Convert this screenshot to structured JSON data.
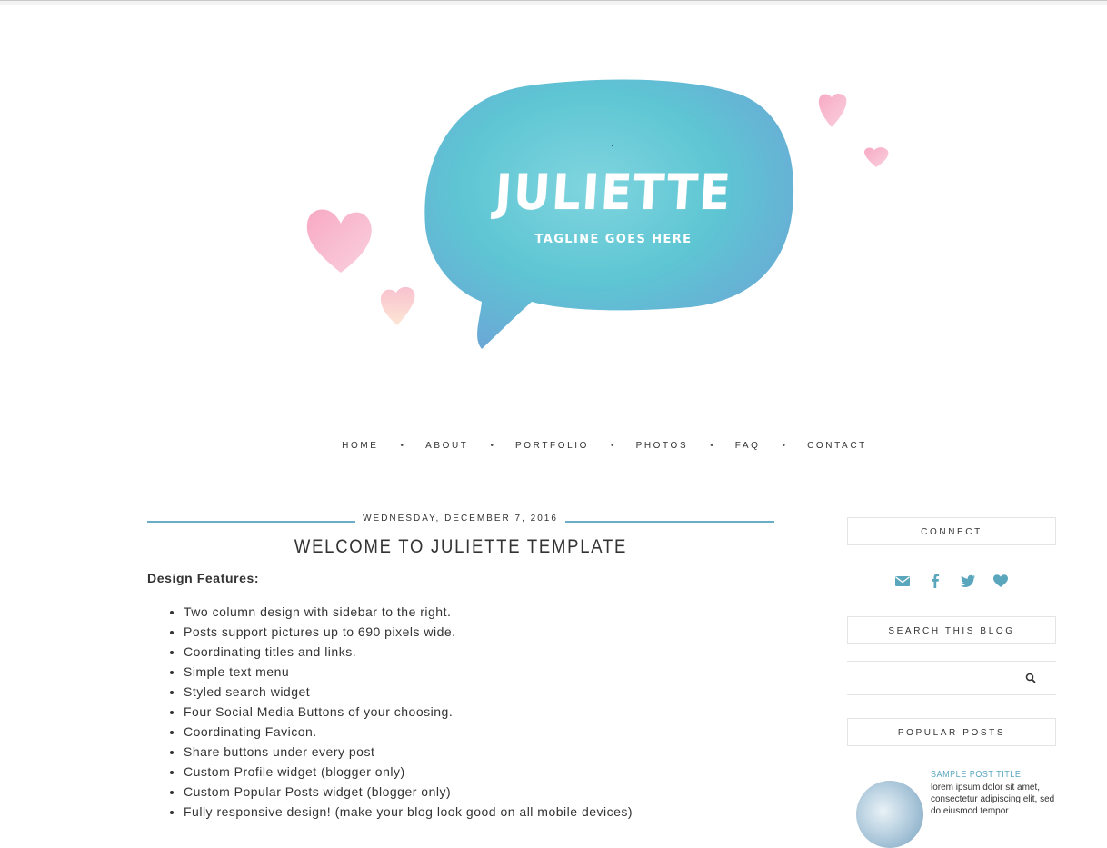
{
  "header": {
    "blog_title": "JULIETTE",
    "tagline": "TAGLINE GOES HERE"
  },
  "menu": {
    "items": [
      {
        "label": "HOME"
      },
      {
        "label": "ABOUT"
      },
      {
        "label": "PORTFOLIO"
      },
      {
        "label": "PHOTOS"
      },
      {
        "label": "FAQ"
      },
      {
        "label": "CONTACT"
      }
    ],
    "separator": "•"
  },
  "post": {
    "date": "Wednesday, December 7, 2016",
    "title": "WELCOME TO JULIETTE TEMPLATE",
    "features_heading": "Design Features:",
    "features": [
      "Two column design with sidebar to the right.",
      "Posts support pictures up to 690 pixels wide.",
      "Coordinating titles and links.",
      "Simple text menu",
      "Styled search widget",
      "Four Social Media Buttons of your choosing.",
      "Coordinating Favicon.",
      "Share buttons under every post",
      "Custom Profile widget (blogger only)",
      "Custom Popular Posts widget (blogger only)",
      "Fully responsive design! (make your blog look good on all mobile devices)"
    ]
  },
  "sidebar": {
    "connect_title": "CONNECT",
    "social_icons": [
      "email-icon",
      "facebook-icon",
      "twitter-icon",
      "heart-icon"
    ],
    "search_title": "SEARCH THIS BLOG",
    "search_placeholder": "",
    "popular_title": "POPULAR POSTS",
    "popular_posts": [
      {
        "title": "SAMPLE POST TITLE",
        "snippet": "lorem ipsum dolor sit amet, consectetur adipiscing elit, sed do eiusmod tempor"
      }
    ]
  },
  "colors": {
    "accent": "#69aec5",
    "icon": "#5aa6bd",
    "bubble": "#5dc6d4",
    "heart_pink": "#f6b8cc",
    "text": "#333333"
  }
}
